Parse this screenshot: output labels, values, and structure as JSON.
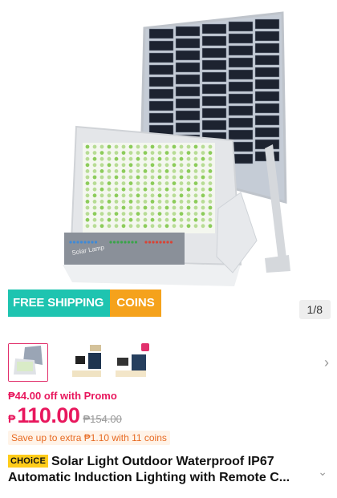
{
  "banner": {
    "free_shipping": "FREE SHIPPING",
    "coins": "COINS"
  },
  "gallery": {
    "counter": "1/8"
  },
  "product_image": {
    "lamp_label": "Solar Lamp"
  },
  "promo": {
    "text": "₱44.00 off with Promo"
  },
  "price": {
    "currency": "₱",
    "value": "110.00",
    "original": "₱154.00"
  },
  "save": {
    "text": "Save up to extra ₱1.10 with 11 coins"
  },
  "title": {
    "badge": "CHOiCE",
    "text": "Solar Light Outdoor Waterproof IP67 Automatic Induction Lighting with Remote C..."
  },
  "colors": {
    "accent": "#e8175d",
    "shipping": "#1ec4b0",
    "coins": "#f5a21c",
    "choice": "#ffcc1a"
  }
}
